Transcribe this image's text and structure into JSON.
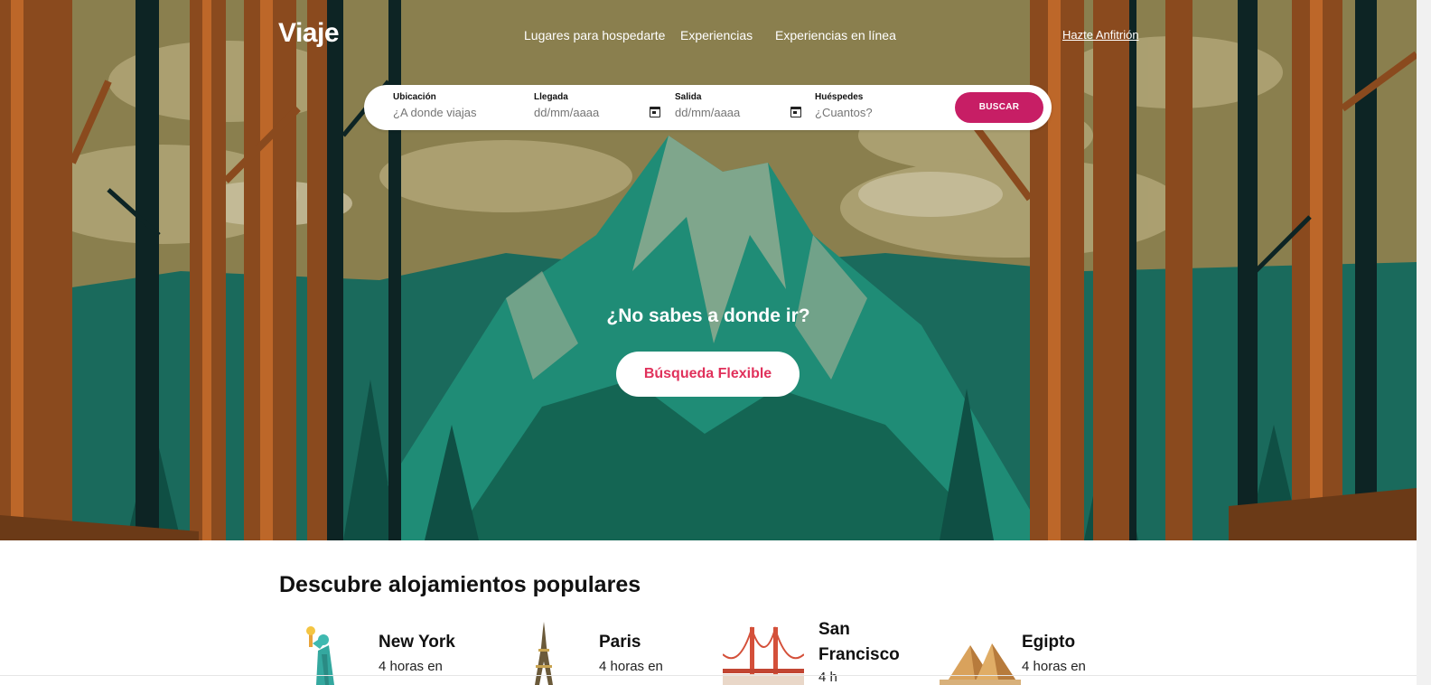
{
  "header": {
    "logo": "Viaje",
    "nav": [
      "Lugares para hospedarte",
      "Experiencias",
      "Experiencias en línea"
    ],
    "host_link": "Hazte Anfitrión"
  },
  "search": {
    "location": {
      "label": "Ubicación",
      "placeholder": "¿A donde viajas"
    },
    "checkin": {
      "label": "Llegada",
      "value": "dd/mm/aaaa"
    },
    "checkout": {
      "label": "Salida",
      "value": "dd/mm/aaaa"
    },
    "guests": {
      "label": "Huéspedes",
      "placeholder": "¿Cuantos?"
    },
    "button": "BUSCAR"
  },
  "hero": {
    "question": "¿No sabes a donde ir?",
    "button": "Búsqueda Flexible",
    "colors": {
      "sky": "#8a7f4e",
      "mountain": "#1f8c76",
      "search_button": "#c71e65",
      "cta_text": "#e0315b"
    }
  },
  "popular": {
    "title": "Descubre alojamientos populares",
    "items": [
      {
        "name": "New York",
        "subtitle": "4 horas en",
        "icon": "statue-of-liberty-icon"
      },
      {
        "name": "Paris",
        "subtitle": "4 horas en",
        "icon": "eiffel-tower-icon"
      },
      {
        "name": "San Francisco",
        "subtitle": "4 h",
        "icon": "golden-gate-icon"
      },
      {
        "name": "Egipto",
        "subtitle": "4 horas en",
        "icon": "pyramids-icon"
      }
    ]
  }
}
